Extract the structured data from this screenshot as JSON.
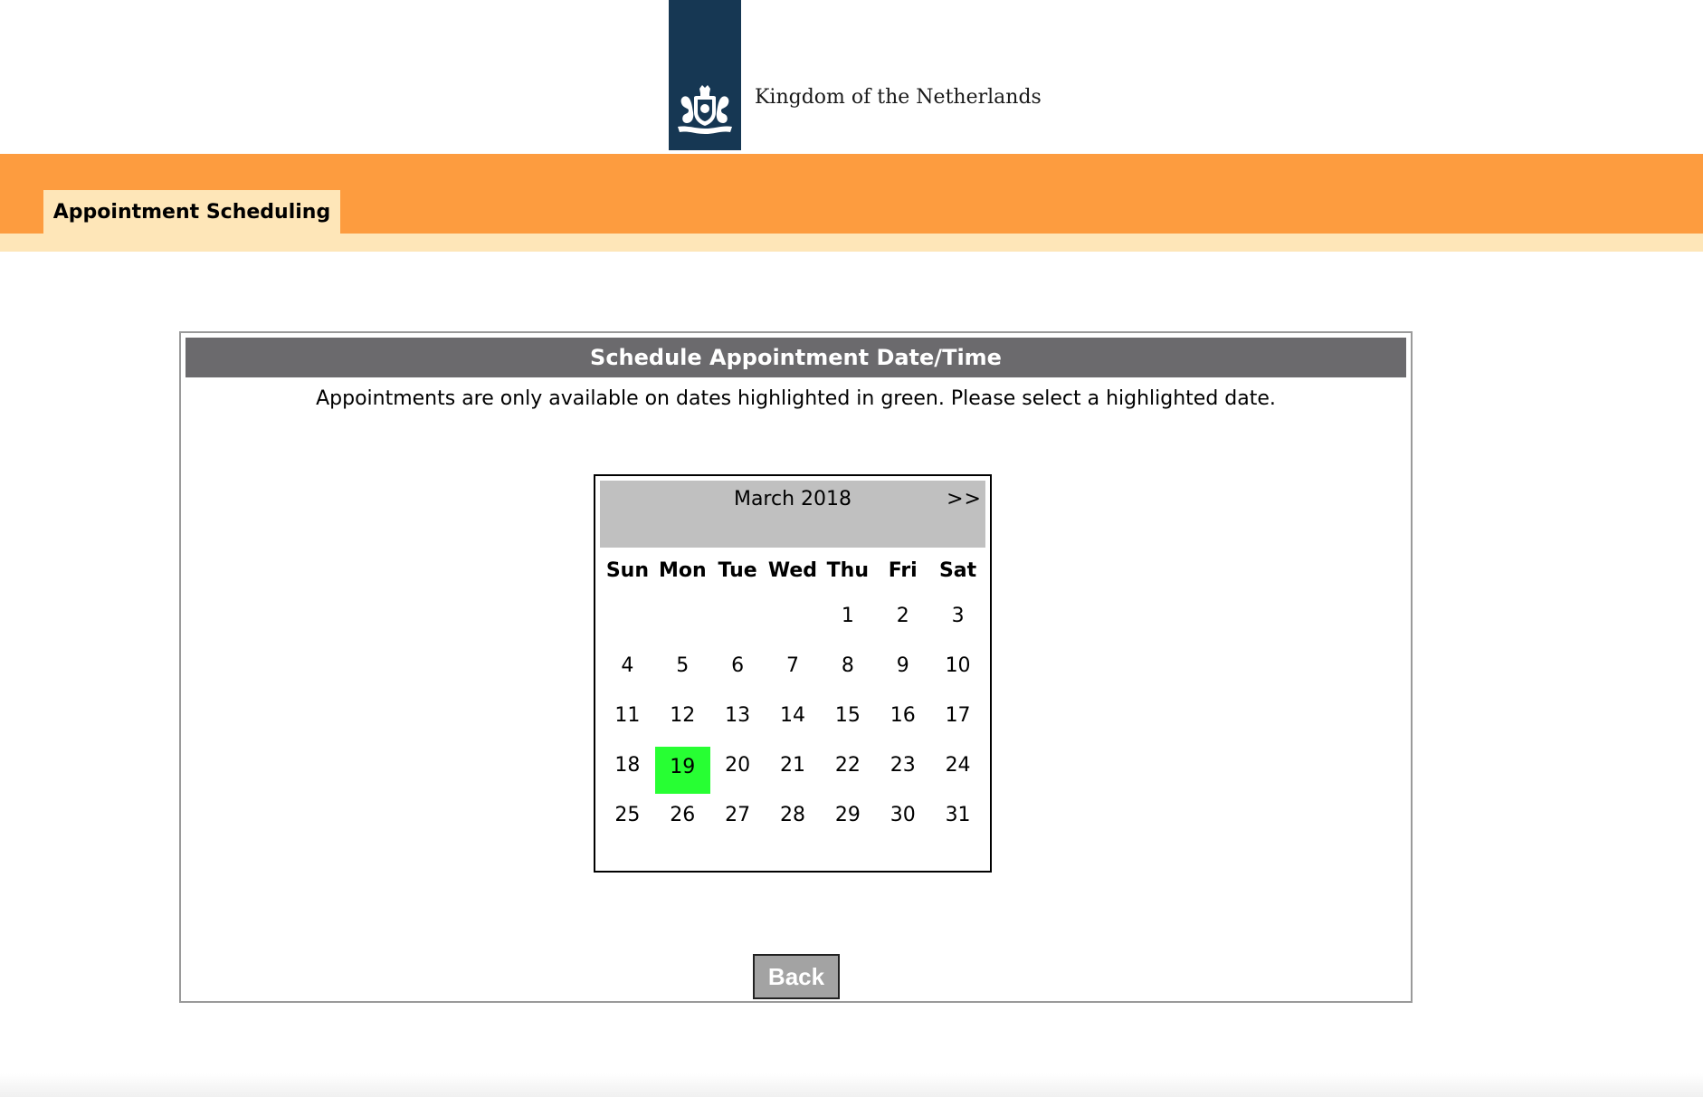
{
  "header": {
    "org_name": "Kingdom of the Netherlands",
    "brand_color": "#163753",
    "crest_icon": "royal-crest-icon"
  },
  "nav": {
    "band_color": "#fd9c3f",
    "tab_color": "#fee6b8",
    "active_tab": "Appointment Scheduling"
  },
  "panel": {
    "title": "Schedule Appointment Date/Time",
    "instructions": "Appointments are only available on dates highlighted in green. Please select a highlighted date."
  },
  "calendar": {
    "month_label": "March 2018",
    "next_label": ">>",
    "weekdays": [
      "Sun",
      "Mon",
      "Tue",
      "Wed",
      "Thu",
      "Fri",
      "Sat"
    ],
    "first_weekday_index": 4,
    "days": [
      "1",
      "2",
      "3",
      "4",
      "5",
      "6",
      "7",
      "8",
      "9",
      "10",
      "11",
      "12",
      "13",
      "14",
      "15",
      "16",
      "17",
      "18",
      "19",
      "20",
      "21",
      "22",
      "23",
      "24",
      "25",
      "26",
      "27",
      "28",
      "29",
      "30",
      "31"
    ],
    "available_days": [
      "19"
    ],
    "available_color": "#27ff33"
  },
  "actions": {
    "back_label": "Back"
  }
}
